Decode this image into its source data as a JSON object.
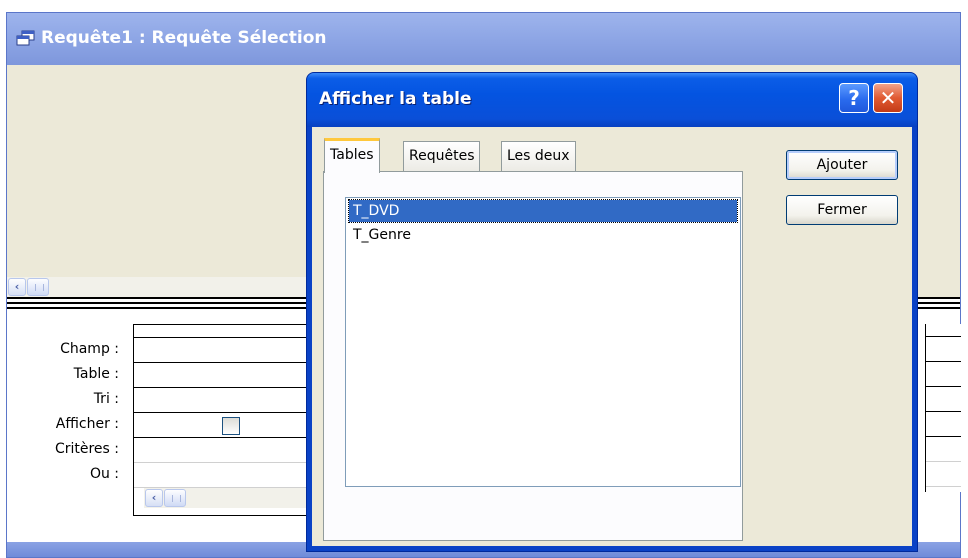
{
  "query_window": {
    "title": "Requête1 : Requête Sélection",
    "row_labels": [
      "Champ :",
      "Table :",
      "Tri :",
      "Afficher :",
      "Critères :",
      "Ou :"
    ]
  },
  "dialog": {
    "title": "Afficher la table",
    "help_glyph": "?",
    "close_glyph": "✕",
    "tabs": [
      {
        "label": "Tables",
        "active": true
      },
      {
        "label": "Requêtes",
        "active": false
      },
      {
        "label": "Les deux",
        "active": false
      }
    ],
    "list_items": [
      {
        "label": "T_DVD",
        "selected": true
      },
      {
        "label": "T_Genre",
        "selected": false
      }
    ],
    "buttons": {
      "add": "Ajouter",
      "close": "Fermer"
    }
  },
  "icons": {
    "scroll_left": "‹"
  },
  "colors": {
    "titlebar_inactive": "#8fa7e6",
    "titlebar_active": "#0454e1",
    "selection": "#316ac5",
    "close_button": "#e15a32"
  }
}
